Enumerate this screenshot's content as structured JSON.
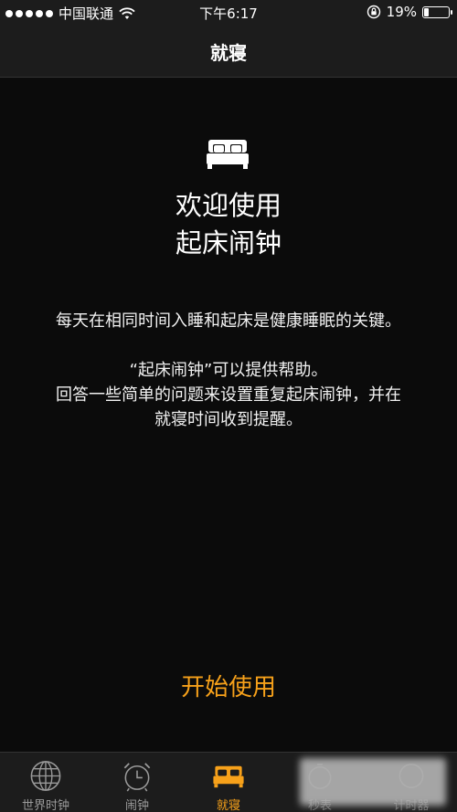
{
  "status_bar": {
    "carrier": "中国联通",
    "time": "下午6:17",
    "battery_percent": "19%",
    "battery_level": 0.19
  },
  "nav": {
    "title": "就寝"
  },
  "content": {
    "welcome_line1": "欢迎使用",
    "welcome_line2": "起床闹钟",
    "para1": "每天在相同时间入睡和起床是健康睡眠的关键。",
    "para2_line1": "“起床闹钟”可以提供帮助。",
    "para2_line2": "回答一些简单的问题来设置重复起床闹钟，并在就寝时间收到提醒。",
    "start_button": "开始使用"
  },
  "tabbar": {
    "tabs": [
      {
        "label": "世界时钟",
        "icon": "globe-icon"
      },
      {
        "label": "闹钟",
        "icon": "alarm-clock-icon"
      },
      {
        "label": "就寝",
        "icon": "bed-icon",
        "active": true
      },
      {
        "label": "秒表",
        "icon": "stopwatch-icon"
      },
      {
        "label": "计时器",
        "icon": "timer-icon"
      }
    ]
  },
  "colors": {
    "accent": "#f7a11a",
    "background": "#0b0b0b",
    "bar": "#1c1c1c",
    "inactive_tab": "#9a9a9a"
  }
}
